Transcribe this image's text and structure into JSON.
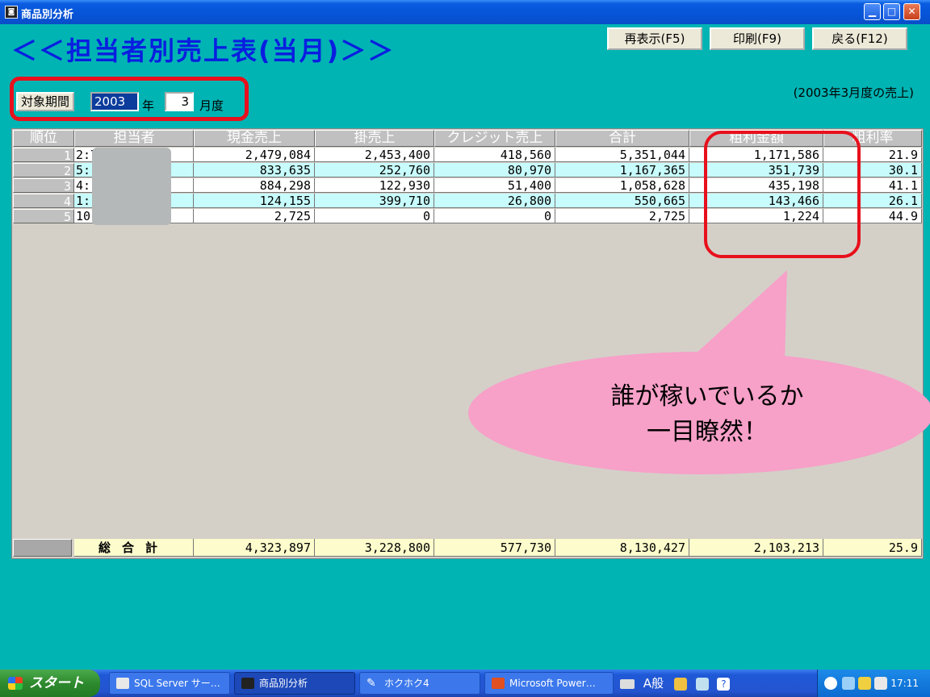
{
  "window": {
    "title": "商品別分析",
    "app_icon": "app-icon",
    "controls": {
      "minimize": "minimize-icon",
      "maximize": "maximize-icon",
      "close": "close-icon"
    }
  },
  "heading": "＜＜担当者別売上表(当月)＞＞",
  "commands": {
    "refresh": "再表示(F5)",
    "print": "印刷(F9)",
    "back": "戻る(F12)"
  },
  "period": {
    "label": "対象期間",
    "year": "2003",
    "year_suffix": "年",
    "month": "3",
    "month_suffix": "月度"
  },
  "caption": "(2003年3月度の売上)",
  "table": {
    "columns": [
      "順位",
      "担当者",
      "現金売上",
      "掛売上",
      "クレジット売上",
      "合計",
      "粗利金額",
      "粗利率"
    ],
    "rows": [
      {
        "rank": "1",
        "name": "2:7",
        "cash": "2,479,084",
        "credit_sales": "2,453,400",
        "card": "418,560",
        "total": "5,351,044",
        "gross_profit": "1,171,586",
        "margin": "21.9"
      },
      {
        "rank": "2",
        "name": "5:(",
        "cash": "833,635",
        "credit_sales": "252,760",
        "card": "80,970",
        "total": "1,167,365",
        "gross_profit": "351,739",
        "margin": "30.1"
      },
      {
        "rank": "3",
        "name": "4:",
        "cash": "884,298",
        "credit_sales": "122,930",
        "card": "51,400",
        "total": "1,058,628",
        "gross_profit": "435,198",
        "margin": "41.1"
      },
      {
        "rank": "4",
        "name": "1:",
        "cash": "124,155",
        "credit_sales": "399,710",
        "card": "26,800",
        "total": "550,665",
        "gross_profit": "143,466",
        "margin": "26.1"
      },
      {
        "rank": "5",
        "name": "10.",
        "cash": "2,725",
        "credit_sales": "0",
        "card": "0",
        "total": "2,725",
        "gross_profit": "1,224",
        "margin": "44.9"
      }
    ],
    "totals": {
      "label": "総合計",
      "cash": "4,323,897",
      "credit_sales": "3,228,800",
      "card": "577,730",
      "total": "8,130,427",
      "gross_profit": "2,103,213",
      "margin": "25.9"
    }
  },
  "callout": {
    "line1": "誰が稼いでいるか",
    "line2": "一目瞭然！",
    "color": "#f7a0c8",
    "highlight_color": "#e8101c"
  },
  "taskbar": {
    "start": "スタート",
    "tasks": [
      {
        "label": "SQL Server サー…",
        "icon": "sql-server-icon"
      },
      {
        "label": "商品別分析",
        "icon": "app-icon"
      },
      {
        "label": "ホクホク4",
        "icon": "pen-icon"
      },
      {
        "label": "Microsoft Power…",
        "icon": "powerpoint-icon"
      }
    ],
    "ime_text": "A般",
    "clock": "17:11"
  },
  "colors": {
    "background": "#00b4b4",
    "heading": "#0a1ee0",
    "row_alt": "#c8fcfc",
    "totals_row": "#fcfccc"
  }
}
